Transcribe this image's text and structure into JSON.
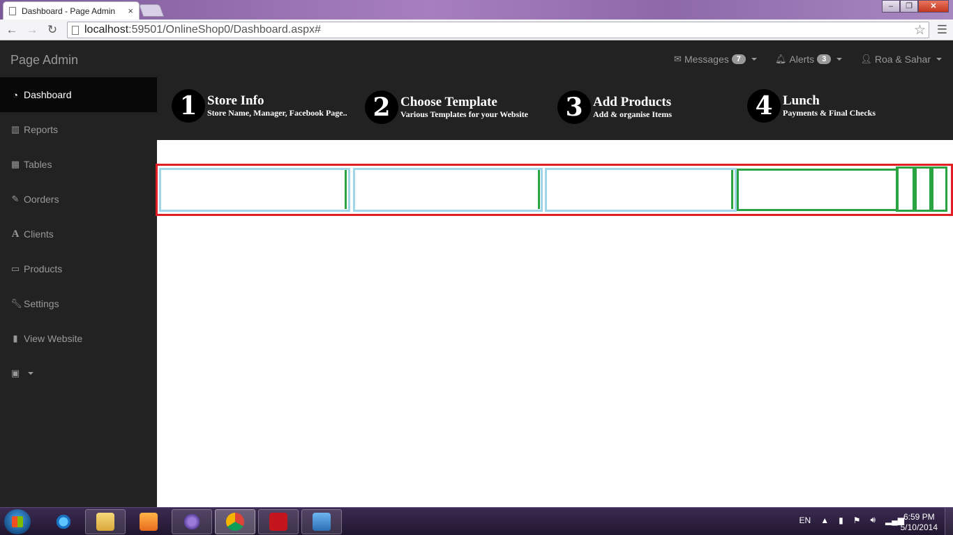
{
  "browser": {
    "tab_title": "Dashboard - Page Admin",
    "tab_close": "×",
    "url_host": "localhost",
    "url_path": ":59501/OnlineShop0/Dashboard.aspx#"
  },
  "topnav": {
    "brand": "Page Admin",
    "messages": {
      "label": "Messages",
      "count": "7"
    },
    "alerts": {
      "label": "Alerts",
      "count": "3"
    },
    "user": {
      "label": "Roa & Sahar"
    }
  },
  "sidebar": {
    "items": [
      {
        "label": "Dashboard",
        "icon": "dashboard-icon",
        "active": true
      },
      {
        "label": "Reports",
        "icon": "bar-chart-icon"
      },
      {
        "label": "Tables",
        "icon": "table-icon"
      },
      {
        "label": "Oorders",
        "icon": "edit-icon"
      },
      {
        "label": "Clients",
        "icon": "font-icon"
      },
      {
        "label": "Products",
        "icon": "desktop-icon"
      },
      {
        "label": "Settings",
        "icon": "wrench-icon"
      },
      {
        "label": "View Website",
        "icon": "file-icon"
      }
    ]
  },
  "steps": [
    {
      "number": "1",
      "title": "Store Info",
      "subtitle": "Store Name, Manager, Facebook Page.."
    },
    {
      "number": "2",
      "title": "Choose Template",
      "subtitle": "Various Templates for your Website"
    },
    {
      "number": "3",
      "title": "Add Products",
      "subtitle": "Add & organise Items"
    },
    {
      "number": "4",
      "title": "Lunch",
      "subtitle": "Payments & Final Checks"
    }
  ],
  "taskbar": {
    "apps": [
      "ie-icon",
      "explorer-icon",
      "media-player-icon",
      "visual-studio-icon",
      "chrome-icon",
      "acrobat-icon",
      "photo-viewer-icon"
    ],
    "language": "EN",
    "time": "6:59 PM",
    "date": "5/10/2014"
  },
  "colors": {
    "nav_bg": "#222222",
    "active_bg": "#080808",
    "frame_red": "#e31e24",
    "box_blue": "#9fd6e8",
    "box_green": "#2aa443"
  }
}
